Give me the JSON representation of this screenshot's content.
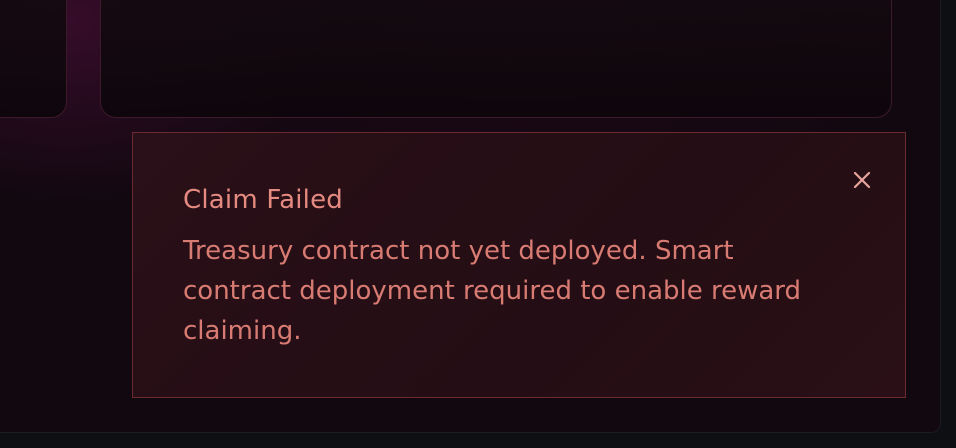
{
  "toast": {
    "title": "Claim Failed",
    "message": "Treasury contract not yet deployed. Smart contract deployment required to enable reward claiming.",
    "close_icon": "close-icon"
  },
  "colors": {
    "toast_background": "#260e15",
    "toast_border": "#6a2a30",
    "toast_text": "#e58a80",
    "page_background": "#120810"
  }
}
